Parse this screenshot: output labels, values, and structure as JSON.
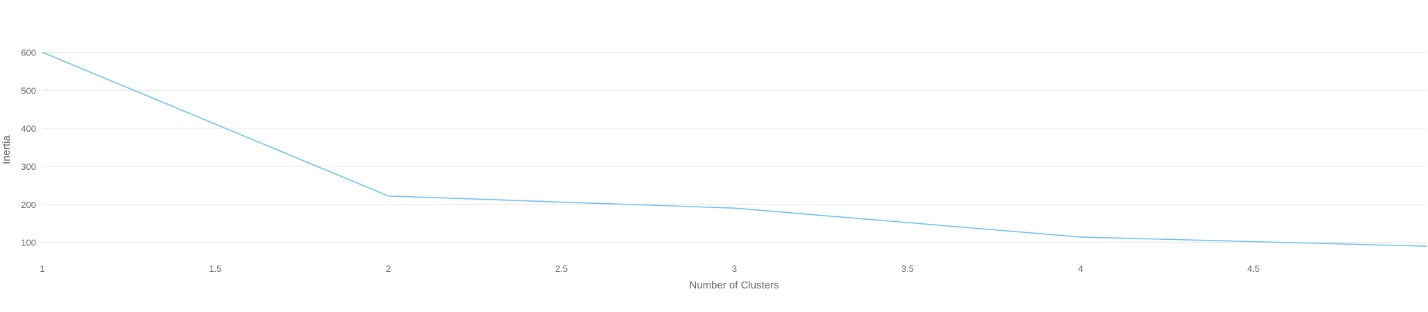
{
  "chart_data": {
    "type": "line",
    "title": "",
    "xlabel": "Number of Clusters",
    "ylabel": "Inertia",
    "xlim": [
      1,
      5
    ],
    "ylim": [
      50,
      650
    ],
    "x_ticks": [
      "1",
      "1.5",
      "2",
      "2.5",
      "3",
      "3.5",
      "4",
      "4.5"
    ],
    "y_ticks": [
      "100",
      "200",
      "300",
      "400",
      "500",
      "600"
    ],
    "grid": "horizontal",
    "legend": "none",
    "series": [
      {
        "color": "#72bef2",
        "x": [
          1,
          2,
          3,
          4,
          5
        ],
        "y": [
          600,
          222,
          190,
          114,
          90
        ]
      }
    ]
  }
}
